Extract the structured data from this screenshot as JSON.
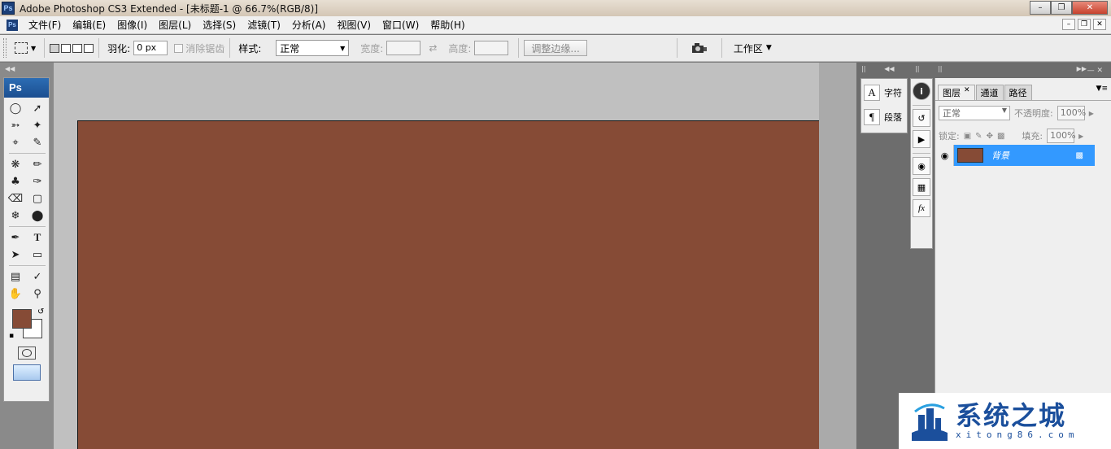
{
  "window": {
    "title": "Adobe Photoshop CS3 Extended - [未标题-1 @ 66.7%(RGB/8)]",
    "app_icon": "Ps",
    "controls": [
      "minimize-icon",
      "restore-icon",
      "close-icon"
    ]
  },
  "menubar": {
    "items": [
      "文件(F)",
      "编辑(E)",
      "图像(I)",
      "图层(L)",
      "选择(S)",
      "滤镜(T)",
      "分析(A)",
      "视图(V)",
      "窗口(W)",
      "帮助(H)"
    ]
  },
  "options": {
    "feather_label": "羽化:",
    "feather_value": "0 px",
    "antialias_label": "消除锯齿",
    "style_label": "样式:",
    "style_value": "正常",
    "width_label": "宽度:",
    "height_label": "高度:",
    "refine_label": "调整边缘...",
    "workspace_label": "工作区"
  },
  "toolbox": {
    "logo": "Ps",
    "fg_color": "#864b36",
    "bg_color": "#ffffff"
  },
  "canvas": {
    "fill_color": "#864b36",
    "zoom": "66.7%"
  },
  "dock": {
    "char_panel": {
      "character_label": "字符",
      "paragraph_label": "段落"
    },
    "layers_panel": {
      "tabs": [
        "图层",
        "通道",
        "路径"
      ],
      "blend_mode": "正常",
      "opacity_label": "不透明度:",
      "opacity_value": "100%",
      "lock_label": "锁定:",
      "fill_label": "填充:",
      "fill_value": "100%",
      "layers": [
        {
          "name": "背景",
          "color": "#864b36",
          "visible": true,
          "locked": true
        }
      ]
    }
  },
  "watermark": {
    "main_text": "系统之城",
    "sub_text": "xitong86.com"
  }
}
